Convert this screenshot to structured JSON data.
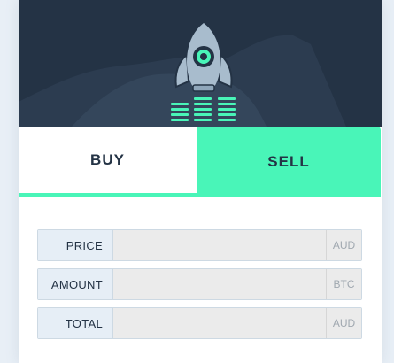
{
  "hero": {
    "icon": "rocket-icon",
    "colors": {
      "background": "#243345",
      "rocket": "#a8bccd",
      "accent": "#49f5b8"
    }
  },
  "tabs": {
    "buy_label": "BUY",
    "sell_label": "SELL",
    "active": "SELL"
  },
  "form": {
    "rows": [
      {
        "label": "PRICE",
        "value": "",
        "unit": "AUD"
      },
      {
        "label": "AMOUNT",
        "value": "",
        "unit": "BTC"
      },
      {
        "label": "TOTAL",
        "value": "",
        "unit": "AUD"
      }
    ]
  }
}
